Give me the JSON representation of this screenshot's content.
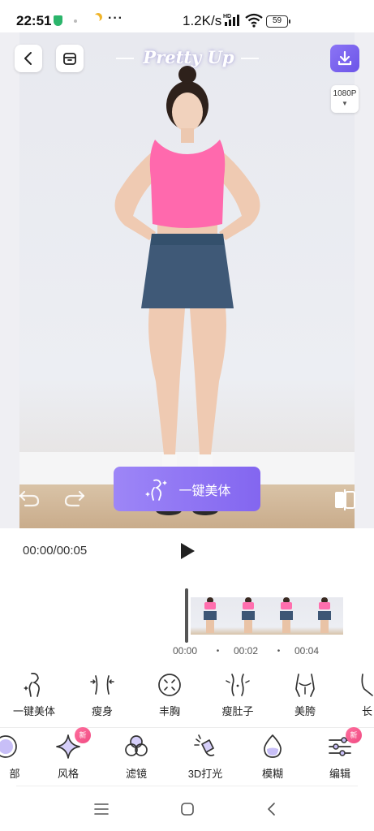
{
  "status_bar": {
    "time": "22:51",
    "more": "···",
    "network_speed": "1.2K/s",
    "signal_badge": "HD",
    "battery": "59"
  },
  "editor": {
    "logo": "Pretty Up",
    "resolution": "1080P",
    "one_key_beauty_label": "一键美体"
  },
  "playback": {
    "time": "00:00/00:05"
  },
  "timeline": {
    "labels": [
      "00:00",
      "00:02",
      "00:04"
    ],
    "frame_count": 4
  },
  "tools": [
    {
      "label": "一键美体",
      "icon": "body-silhouette-icon"
    },
    {
      "label": "瘦身",
      "icon": "waist-slim-icon"
    },
    {
      "label": "丰胸",
      "icon": "chest-enhance-icon"
    },
    {
      "label": "瘦肚子",
      "icon": "belly-slim-icon"
    },
    {
      "label": "美胯",
      "icon": "hip-shape-icon"
    },
    {
      "label": "长",
      "icon": "leg-lengthen-icon"
    }
  ],
  "categories": [
    {
      "label": "部",
      "icon": "face-icon",
      "new": false
    },
    {
      "label": "风格",
      "icon": "sparkle-icon",
      "new": true,
      "badge": "新"
    },
    {
      "label": "滤镜",
      "icon": "filter-circles-icon",
      "new": false
    },
    {
      "label": "3D打光",
      "icon": "spotlight-icon",
      "new": false
    },
    {
      "label": "模糊",
      "icon": "droplet-icon",
      "new": false
    },
    {
      "label": "编辑",
      "icon": "sliders-icon",
      "new": true,
      "badge": "新"
    }
  ],
  "colors": {
    "accent": "#8366f0",
    "accent_light": "#9d86f7",
    "badge": "#f04b83"
  }
}
